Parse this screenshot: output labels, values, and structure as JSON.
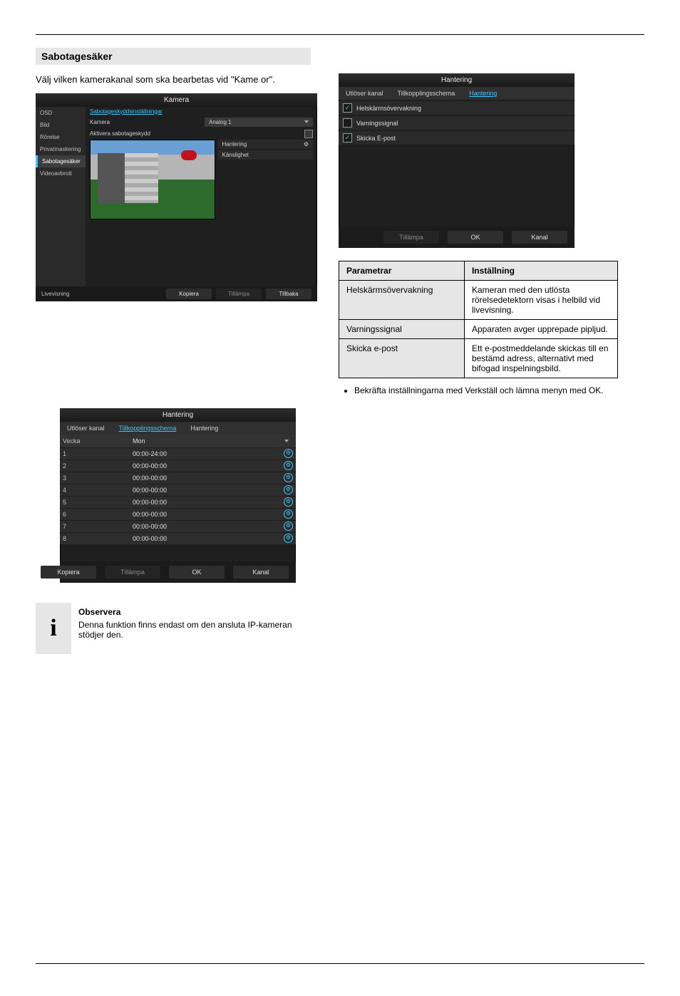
{
  "section_title": "Sabotagesäker",
  "intro_text": "Välj vilken kamerakanal som ska bearbetas vid \"Kame or\".",
  "camera_panel": {
    "title": "Kamera",
    "side_items": [
      "OSD",
      "Bild",
      "Rörelse",
      "Privatmaskering",
      "Sabotagesäker",
      "Videoavbrott"
    ],
    "settings_link": "Sabotageskyddsinställningar",
    "field_camera": "Kamera",
    "value_camera": "Analog 1",
    "field_activate": "Aktivera sabotageskydd",
    "field_hantering": "Hantering",
    "field_sens": "Känslighet",
    "footer_live": "Livevisning",
    "btn_copy": "Kopiera",
    "btn_apply": "Tillämpa",
    "btn_back": "Tillbaka"
  },
  "schedule_panel": {
    "title": "Hantering",
    "tabs": [
      "Utlöser kanal",
      "Tillkopplingsschema",
      "Hantering"
    ],
    "col_week": "Vecka",
    "col_day": "Mon",
    "rows": [
      {
        "n": "1",
        "t": "00:00-24:00"
      },
      {
        "n": "2",
        "t": "00:00-00:00"
      },
      {
        "n": "3",
        "t": "00:00-00:00"
      },
      {
        "n": "4",
        "t": "00:00-00:00"
      },
      {
        "n": "5",
        "t": "00:00-00:00"
      },
      {
        "n": "6",
        "t": "00:00-00:00"
      },
      {
        "n": "7",
        "t": "00:00-00:00"
      },
      {
        "n": "8",
        "t": "00:00-00:00"
      }
    ],
    "btn_copy": "Kopiera",
    "btn_apply": "Tillämpa",
    "btn_ok": "OK",
    "btn_cancel": "Kanal"
  },
  "action_panel": {
    "title": "Hantering",
    "tabs": [
      "Utlöser kanal",
      "Tillkopplingsschema",
      "Hantering"
    ],
    "opts": [
      {
        "label": "Helskärmsövervakning",
        "on": true
      },
      {
        "label": "Varningssignal",
        "on": false
      },
      {
        "label": "Skicka E-post",
        "on": true
      }
    ],
    "btn_apply": "Tillämpa",
    "btn_ok": "OK",
    "btn_cancel": "Kanal"
  },
  "table": {
    "h1": "Parametrar",
    "h2": "Inställning",
    "r1k": "Helskärmsövervakning",
    "r1v": "Kameran med den utlösta rörelsedetektorn visas i helbild vid livevisning.",
    "r2k": "Varningssignal",
    "r2v": "Apparaten avger upprepade pipljud.",
    "r3k": "Skicka e-post",
    "r3v": "Ett e-postmeddelande skickas till en bestämd adress, alternativt med bifogad inspelningsbild."
  },
  "bullet": "Bekräfta inställningarna med Verkställ och lämna menyn med OK.",
  "info_heading": "Observera",
  "info_text": "Denna funktion finns endast om den ansluta IP-kameran stödjer den."
}
